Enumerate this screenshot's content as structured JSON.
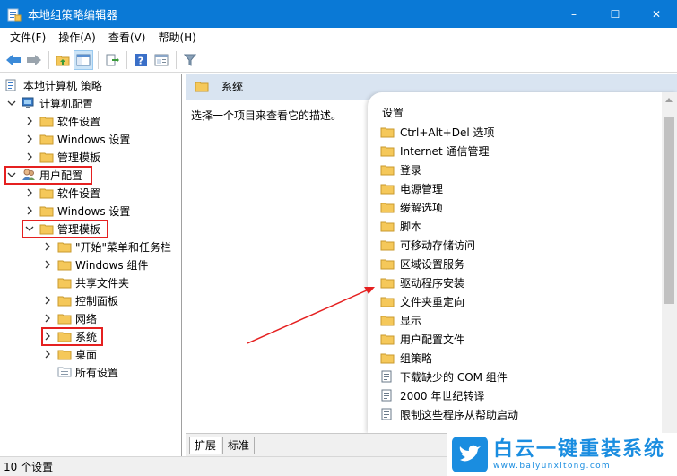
{
  "window": {
    "title": "本地组策略编辑器",
    "controls": {
      "minimize": "–",
      "maximize": "☐",
      "close": "✕"
    }
  },
  "menu": [
    "文件(F)",
    "操作(A)",
    "查看(V)",
    "帮助(H)"
  ],
  "toolbar": [
    "back-arrow-icon",
    "forward-arrow-icon",
    "up-folder-icon",
    "show-hide-tree-icon",
    "export-list-icon",
    "help-icon",
    "extended-view-icon",
    "filter-icon"
  ],
  "tree": {
    "root": "本地计算机 策略",
    "computer_config": "计算机配置",
    "computer_children": [
      "软件设置",
      "Windows 设置",
      "管理模板"
    ],
    "user_config": "用户配置",
    "user_children": [
      "软件设置",
      "Windows 设置"
    ],
    "admin_templates": "管理模板",
    "admin_children": [
      "\"开始\"菜单和任务栏",
      "Windows 组件",
      "共享文件夹",
      "控制面板",
      "网络",
      "系统",
      "桌面",
      "所有设置"
    ]
  },
  "right_pane": {
    "header": "系统",
    "description": "选择一个项目来查看它的描述。",
    "column_header": "设置",
    "items": [
      {
        "label": "Ctrl+Alt+Del 选项",
        "type": "folder"
      },
      {
        "label": "Internet 通信管理",
        "type": "folder"
      },
      {
        "label": "登录",
        "type": "folder"
      },
      {
        "label": "电源管理",
        "type": "folder"
      },
      {
        "label": "缓解选项",
        "type": "folder"
      },
      {
        "label": "脚本",
        "type": "folder"
      },
      {
        "label": "可移动存储访问",
        "type": "folder"
      },
      {
        "label": "区域设置服务",
        "type": "folder"
      },
      {
        "label": "驱动程序安装",
        "type": "folder"
      },
      {
        "label": "文件夹重定向",
        "type": "folder"
      },
      {
        "label": "显示",
        "type": "folder"
      },
      {
        "label": "用户配置文件",
        "type": "folder"
      },
      {
        "label": "组策略",
        "type": "folder"
      },
      {
        "label": "下载缺少的 COM 组件",
        "type": "setting"
      },
      {
        "label": "2000 年世纪转译",
        "type": "setting"
      },
      {
        "label": "限制这些程序从帮助启动",
        "type": "setting"
      }
    ]
  },
  "tabs": [
    "扩展",
    "标准"
  ],
  "status": "10 个设置",
  "brand": {
    "name": "白云一键重装系统",
    "url": "www.baiyunxitong.com"
  },
  "colors": {
    "titlebar": "#0a79d6",
    "highlight_box": "#e52020",
    "folder": "#f5c85a",
    "brand": "#1a8de0"
  }
}
